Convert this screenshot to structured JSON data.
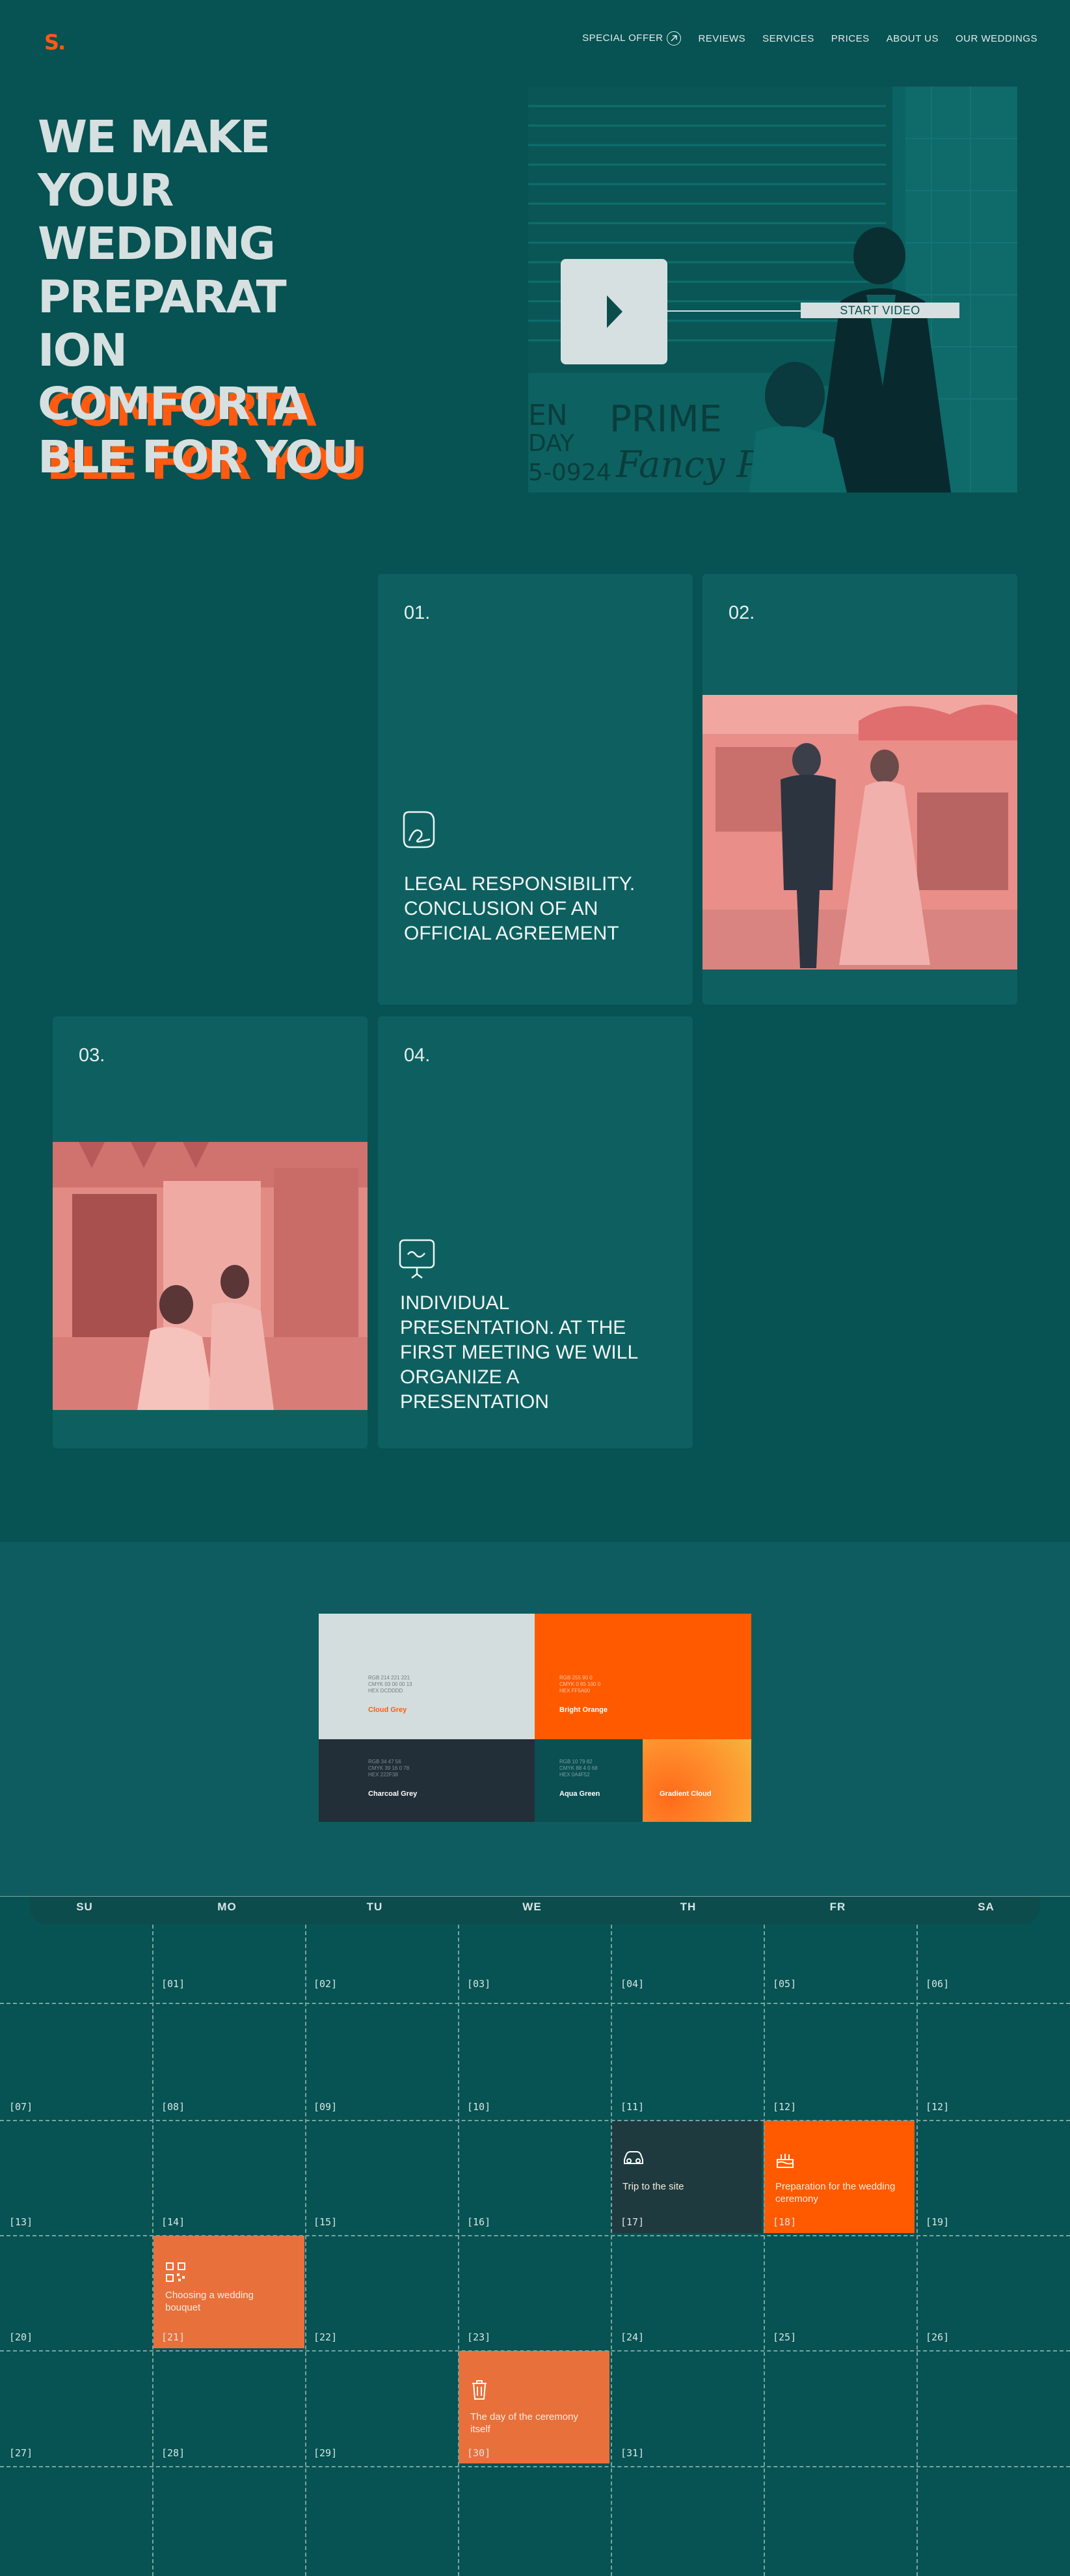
{
  "header": {
    "logo": "S.",
    "nav": [
      {
        "label": "SPECIAL OFFER"
      },
      {
        "label": "REVIEWS"
      },
      {
        "label": "SERVICES"
      },
      {
        "label": "PRICES"
      },
      {
        "label": "ABOUT US"
      },
      {
        "label": "OUR WEDDINGS"
      }
    ]
  },
  "hero": {
    "title_lines": [
      "WE MAKE",
      "YOUR",
      "WEDDING",
      "PREPARAT",
      "ION",
      "COMFORTA",
      "BLE FOR YOU"
    ],
    "video": {
      "start_label": "START VIDEO",
      "sign_line1": "PRIME",
      "sign_line2": "Fancy P",
      "sign_left1": "EN",
      "sign_left2": "DAY",
      "sign_left3": "5-0924"
    }
  },
  "services": [
    {
      "num": "01.",
      "text": "LEGAL RESPONSIBILITY. CONCLUSION OF AN OFFICIAL AGREEMENT",
      "icon": "signature-icon"
    },
    {
      "num": "02.",
      "photo": "couple-street-photo"
    },
    {
      "num": "03.",
      "photo": "bride-friend-photo"
    },
    {
      "num": "04.",
      "text": "INDIVIDUAL PRESENTATION. AT THE FIRST MEETING WE WILL ORGANIZE A PRESENTATION",
      "icon": "presentation-board-icon"
    }
  ],
  "palette": [
    {
      "name": "Cloud Grey",
      "bg": "#d4dddd",
      "meta": "RGB 214 221 221\nCMYK 03 00 00 13\nHEX DCDDDD",
      "fg": "#ff5a10"
    },
    {
      "name": "Bright Orange",
      "bg": "#ff5a00",
      "meta": "RGB 255 90 0\nCMYK 0 65 100 0\nHEX FF5A00",
      "fg": "#ffffff"
    },
    {
      "name": "Charcoal Grey",
      "bg": "#222f38",
      "meta": "RGB 34 47 56\nCMYK 39 16 0 78\nHEX 222F38",
      "fg": "#ffffff"
    },
    {
      "name": "Aqua Green",
      "bg": "#0a4f52",
      "meta": "RGB 10 79 82\nCMYK 88 4 0 68\nHEX 0A4F52",
      "fg": "#ffffff"
    },
    {
      "name": "Gradient Cloud",
      "bg": "#ff8a2a",
      "meta": "",
      "fg": "#ffffff"
    }
  ],
  "calendar": {
    "days": [
      "SU",
      "MO",
      "TU",
      "WE",
      "TH",
      "FR",
      "SA"
    ],
    "rows": [
      [
        "",
        "[01]",
        "[02]",
        "[03]",
        "[04]",
        "[05]",
        "[06]"
      ],
      [
        "[07]",
        "[08]",
        "[09]",
        "[10]",
        "[11]",
        "[12]",
        "[12]"
      ],
      [
        "[13]",
        "[14]",
        "[15]",
        "[16]",
        "[17]",
        "[18]",
        "[19]"
      ],
      [
        "[20]",
        "[21]",
        "[22]",
        "[23]",
        "[24]",
        "[25]",
        "[26]"
      ],
      [
        "[27]",
        "[28]",
        "[29]",
        "[30]",
        "[31]",
        "",
        ""
      ]
    ],
    "events": [
      {
        "title": "Trip to the site",
        "color": "#1e3a3f",
        "icon": "car-icon"
      },
      {
        "title": "Preparation for the wedding ceremony",
        "color": "#ff5a00",
        "icon": "cake-icon"
      },
      {
        "title": "Choosing a wedding bouquet",
        "color": "#e8703a",
        "icon": "qr-code-icon"
      },
      {
        "title": "The day of the ceremony itself",
        "color": "#e8703a",
        "icon": "trash-bin-icon"
      }
    ]
  }
}
